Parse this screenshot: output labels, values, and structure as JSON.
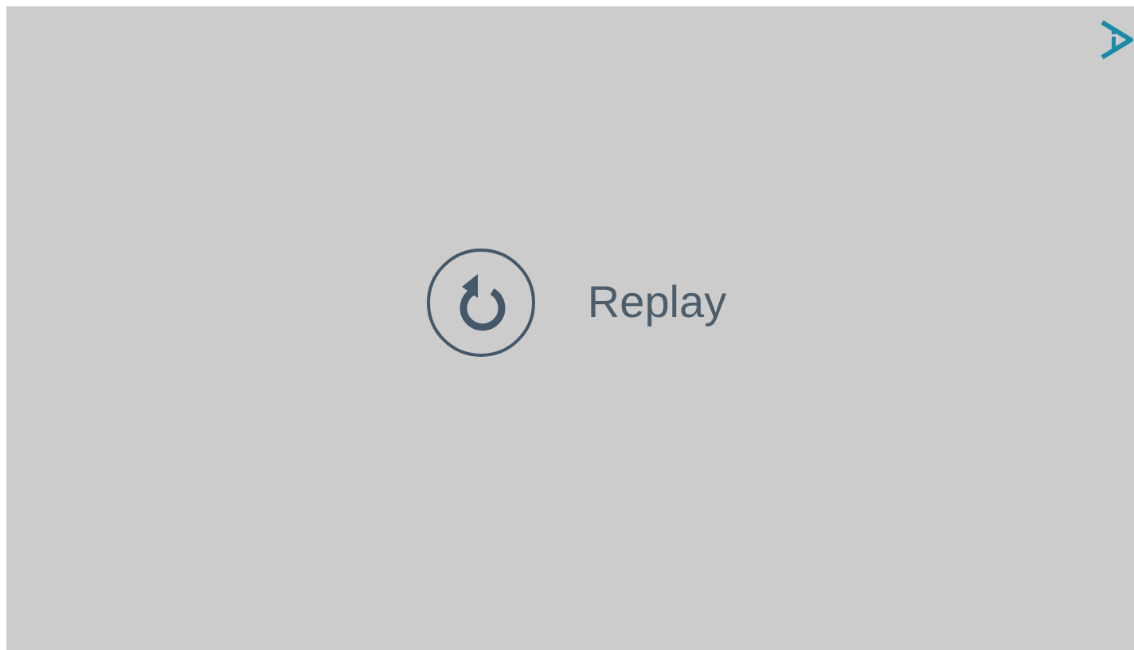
{
  "replay": {
    "label": "Replay"
  }
}
